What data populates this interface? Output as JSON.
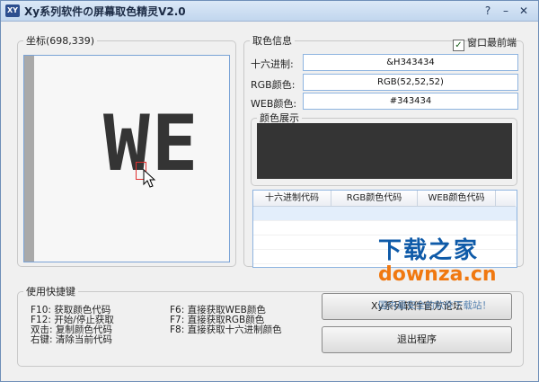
{
  "window": {
    "title": "Xy系列软件の屏幕取色精灵V2.0",
    "icon_text": "XY",
    "buttons": {
      "help": "?",
      "minimize": "–",
      "close": "✕"
    }
  },
  "coordinates": {
    "legend": "坐标(698,339)",
    "magnified_text": "WE"
  },
  "color_info": {
    "legend": "取色信息",
    "topmost_label": "窗口最前端",
    "topmost_checked": true,
    "hex_label": "十六进制:",
    "hex_value": "&H343434",
    "rgb_label": "RGB颜色:",
    "rgb_value": "RGB(52,52,52)",
    "web_label": "WEB颜色:",
    "web_value": "#343434",
    "display_legend": "颜色展示",
    "display_color": "#343434"
  },
  "history": {
    "columns": [
      "十六进制代码",
      "RGB颜色代码",
      "WEB颜色代码"
    ]
  },
  "shortcuts": {
    "legend": "使用快捷键",
    "left": [
      "F10: 获取颜色代码",
      "F12: 开始/停止获取",
      "双击: 复制颜色代码",
      "右键: 清除当前代码"
    ],
    "right": [
      "F6: 直接获取WEB颜色",
      "F7: 直接获取RGB颜色",
      "F8: 直接获取十六进制颜色"
    ]
  },
  "actions": {
    "website_label": "Xy系列软件官方论坛",
    "exit_label": "退出程序"
  },
  "watermark": {
    "line1": "下载之家",
    "line2": "downza.cn",
    "line3": "国内最安全的软件下载站！"
  }
}
